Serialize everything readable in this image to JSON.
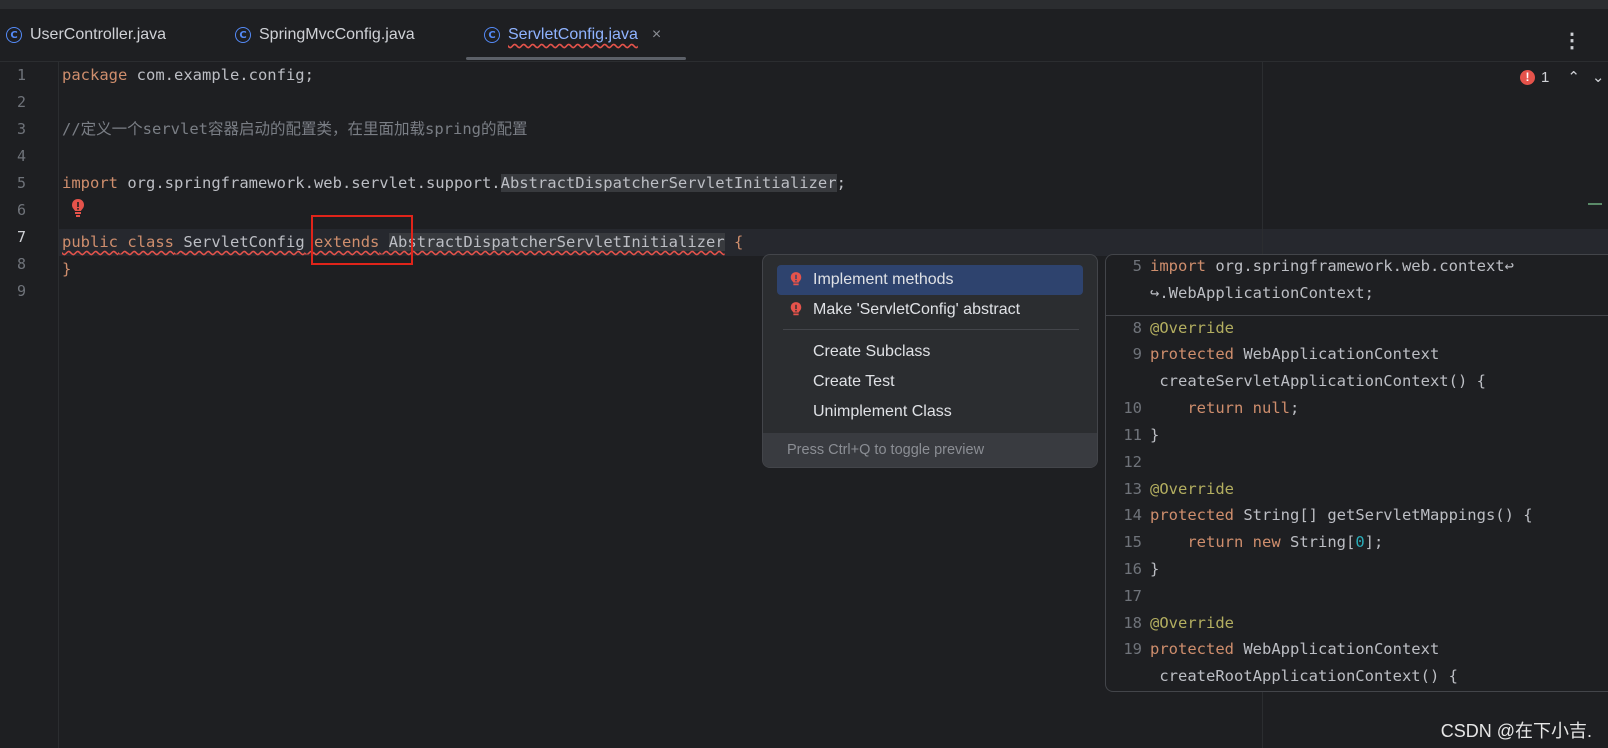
{
  "tabs": [
    {
      "label": "UserController.java",
      "icon": "class-icon"
    },
    {
      "label": "SpringMvcConfig.java",
      "icon": "class-icon"
    },
    {
      "label": "ServletConfig.java",
      "icon": "class-icon",
      "active": true,
      "close": "×"
    }
  ],
  "kebab": "⋮",
  "editor": {
    "line_numbers": [
      "1",
      "2",
      "3",
      "4",
      "5",
      "6",
      "7",
      "8",
      "9"
    ],
    "current_line": "7",
    "line1": {
      "kw": "package",
      "rest": " com.example.config;"
    },
    "line3": {
      "comment": "//定义一个servlet容器启动的配置类，在里面加载spring的配置"
    },
    "line5": {
      "kw": "import",
      "pkg": " org.springframework.web.servlet.support.",
      "cls": "AbstractDispatcherServletInitializer",
      "end": ";"
    },
    "line7": {
      "kw1": "public",
      "kw2": "class",
      "name": "ServletConfig",
      "kw3": "extends",
      "parent": "AbstractDispatcherServletInitializer",
      "brace": "{"
    },
    "line8": {
      "brace": "}"
    }
  },
  "error_indicator": {
    "count": "1",
    "up": "⌃",
    "down": "⌄",
    "color": "#e5534b"
  },
  "popup": {
    "items": [
      {
        "label": "Implement methods",
        "icon": "error-bulb-icon",
        "selected": true
      },
      {
        "label": "Make 'ServletConfig' abstract",
        "icon": "error-bulb-icon"
      },
      {
        "label": "Create Subclass"
      },
      {
        "label": "Create Test"
      },
      {
        "label": "Unimplement Class"
      }
    ],
    "footer": "Press Ctrl+Q to toggle preview"
  },
  "preview": {
    "lines": [
      {
        "n": "5",
        "kw": "import",
        "text": " org.springframework.web.context↩"
      },
      {
        "n": "",
        "text": "↪.WebApplicationContext;"
      },
      {
        "n": "8",
        "an": "@Override"
      },
      {
        "n": "9",
        "kw": "protected",
        "text": " WebApplicationContext"
      },
      {
        "n": "",
        "text": " createServletApplicationContext() {"
      },
      {
        "n": "10",
        "kw": "    return",
        "kw2": " null",
        "text": ";"
      },
      {
        "n": "11",
        "text": "}"
      },
      {
        "n": "12",
        "text": ""
      },
      {
        "n": "13",
        "an": "@Override"
      },
      {
        "n": "14",
        "kw": "protected",
        "text": " String[] getServletMappings() {"
      },
      {
        "n": "15",
        "kw": "    return",
        "kw2": " new",
        "text": " String[",
        "num": "0",
        "text2": "];"
      },
      {
        "n": "16",
        "text": "}"
      },
      {
        "n": "17",
        "text": ""
      },
      {
        "n": "18",
        "an": "@Override"
      },
      {
        "n": "19",
        "kw": "protected",
        "text": " WebApplicationContext"
      },
      {
        "n": "",
        "text": " createRootApplicationContext() {"
      }
    ]
  },
  "watermark": "CSDN @在下小吉."
}
